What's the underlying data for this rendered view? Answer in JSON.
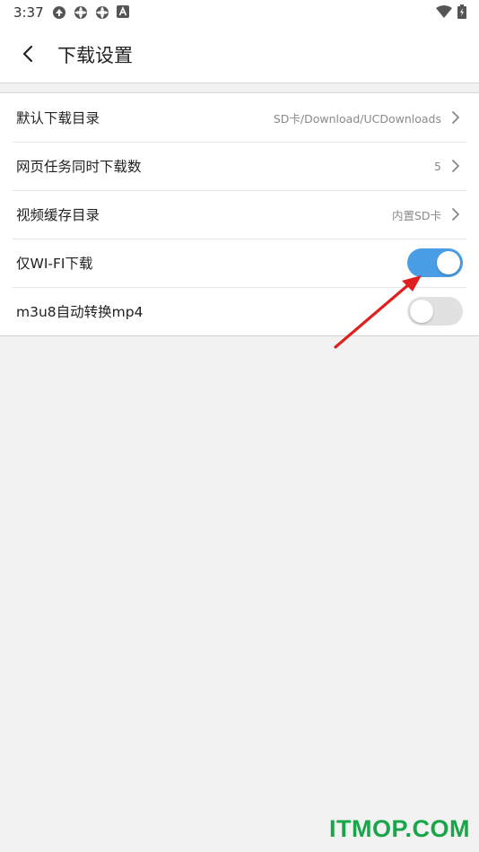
{
  "status_bar": {
    "time": "3:37",
    "icons": [
      "notification-icon",
      "sync-icon",
      "sync-icon",
      "app-a-icon"
    ],
    "right_icons": [
      "wifi-icon",
      "battery-charging-icon"
    ]
  },
  "header": {
    "back_icon": "back-chevron-icon",
    "title": "下载设置"
  },
  "settings": {
    "items": [
      {
        "label": "默认下载目录",
        "value": "SD卡/Download/UCDownloads",
        "type": "link"
      },
      {
        "label": "网页任务同时下载数",
        "value": "5",
        "type": "link"
      },
      {
        "label": "视频缓存目录",
        "value": "内置SD卡",
        "type": "link"
      },
      {
        "label": "仅WI-FI下载",
        "type": "toggle",
        "checked": true
      },
      {
        "label": "m3u8自动转换mp4",
        "type": "toggle",
        "checked": false
      }
    ]
  },
  "colors": {
    "toggle_on": "#4a9ee6",
    "toggle_off": "#e1e1e1",
    "annotation_arrow": "#e02020",
    "watermark": "#1aa54a"
  },
  "watermark": "ITMOP.COM"
}
